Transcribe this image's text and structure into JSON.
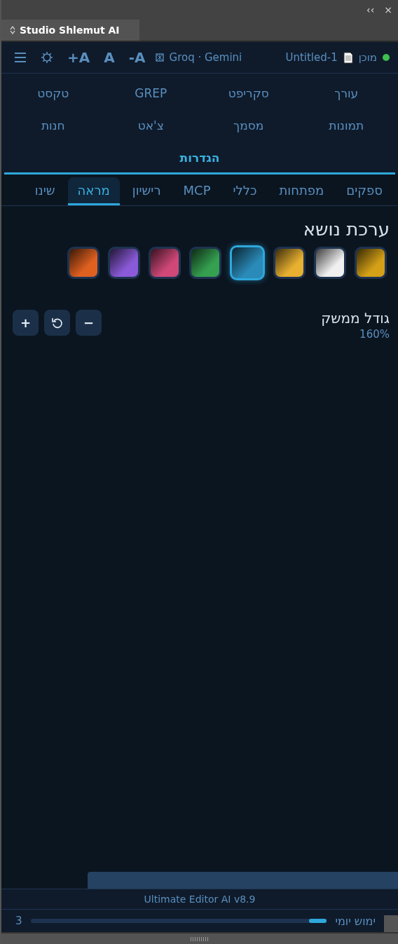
{
  "window": {
    "collapse": "‹‹",
    "close": "×"
  },
  "panel_tab": {
    "title": "Studio Shlemut AI"
  },
  "header": {
    "status": "מוכן",
    "document": "Untitled-1",
    "providers": "Groq · Gemini",
    "font_buttons": [
      "-A",
      "A",
      "+A"
    ]
  },
  "nav": [
    {
      "label": "עורך",
      "selected": false
    },
    {
      "label": "סקריפט",
      "selected": false
    },
    {
      "label": "GREP",
      "selected": false
    },
    {
      "label": "טקסט",
      "selected": false
    },
    {
      "label": "תמונות",
      "selected": false
    },
    {
      "label": "מסמך",
      "selected": false
    },
    {
      "label": "צ'אט",
      "selected": false
    },
    {
      "label": "חנות",
      "selected": false
    },
    {
      "label": "הגדרות",
      "selected": true
    }
  ],
  "subtabs": [
    {
      "label": "ספקים",
      "selected": false
    },
    {
      "label": "מפתחות",
      "selected": false
    },
    {
      "label": "כללי",
      "selected": false
    },
    {
      "label": "MCP",
      "selected": false
    },
    {
      "label": "רישיון",
      "selected": false
    },
    {
      "label": "מראה",
      "selected": true
    },
    {
      "label": "שינו",
      "selected": false
    }
  ],
  "theme": {
    "title": "ערכת נושא",
    "swatches": [
      {
        "color": "#d4a017",
        "selected": false
      },
      {
        "color": "#f0f0f0",
        "selected": false
      },
      {
        "color": "#e8b030",
        "selected": false
      },
      {
        "color": "#2a8ab8",
        "selected": true
      },
      {
        "color": "#35a050",
        "selected": false
      },
      {
        "color": "#d04878",
        "selected": false
      },
      {
        "color": "#8a5ad8",
        "selected": false
      },
      {
        "color": "#e06020",
        "selected": false
      }
    ]
  },
  "interface_size": {
    "label": "גודל ממשק",
    "value": "160%",
    "buttons": [
      "−",
      "+"
    ]
  },
  "footer": {
    "version": "Ultimate Editor AI v8.9",
    "usage_label": "ימוש יומי",
    "usage": {
      "level": 0.06
    },
    "usage_count": "3"
  }
}
